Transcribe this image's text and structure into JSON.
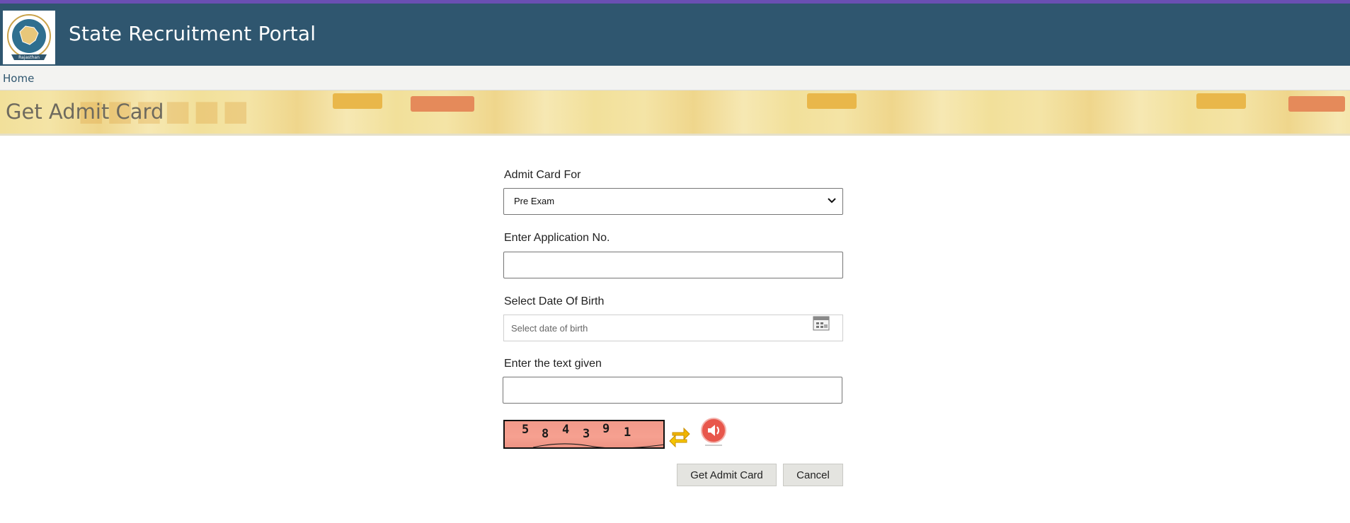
{
  "header": {
    "title": "State Recruitment Portal",
    "logo_icon": "state-emblem-logo",
    "logo_text": "Rajasthan"
  },
  "nav": {
    "home_label": "Home"
  },
  "banner": {
    "page_title": "Get Admit Card"
  },
  "form": {
    "admit_card_for": {
      "label": "Admit Card For",
      "selected": "Pre Exam"
    },
    "application_no": {
      "label": "Enter Application No.",
      "value": ""
    },
    "dob": {
      "label": "Select Date Of Birth",
      "placeholder": "Select date of birth",
      "icon": "calendar-icon"
    },
    "captcha_input": {
      "label": "Enter the text given",
      "value": ""
    },
    "captcha": {
      "digits": [
        "5",
        "8",
        "4",
        "3",
        "9",
        "1"
      ],
      "refresh_icon": "refresh-icon",
      "audio_icon": "audio-speaker-icon"
    },
    "buttons": {
      "submit_label": "Get Admit Card",
      "cancel_label": "Cancel"
    }
  },
  "colors": {
    "top_strip": "#6a4fb3",
    "header_bg": "#2f566f",
    "banner_bg": "#f2e09a",
    "captcha_bg": "#f29a8a"
  }
}
